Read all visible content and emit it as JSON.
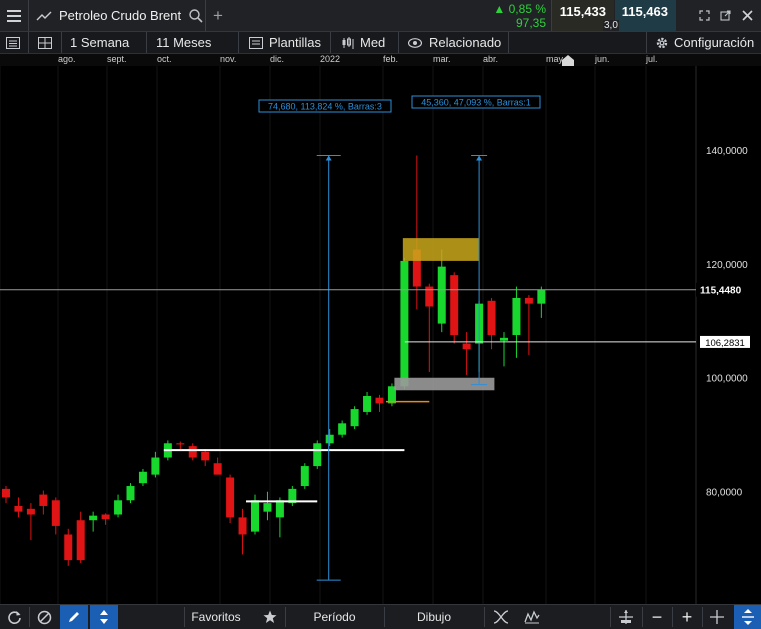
{
  "header": {
    "instrument": "Petroleo Crudo Brent",
    "change_pct": "▲ 0,85 %",
    "change_abs": "97,35",
    "sell": "115,433",
    "buy": "115,463",
    "spread": "3,0"
  },
  "toolbar": {
    "period": "1 Semana",
    "range": "11 Meses",
    "templates": "Plantillas",
    "chart_type": "Med",
    "related": "Relacionado",
    "settings": "Configuración"
  },
  "time_axis": {
    "labels": [
      "ago.",
      "sept.",
      "oct.",
      "nov.",
      "dic.",
      "2022",
      "feb.",
      "mar.",
      "abr.",
      "may.",
      "jun.",
      "jul."
    ]
  },
  "chart_data": {
    "type": "candlestick",
    "instrument": "Petroleo Crudo Brent",
    "interval": "1 Semana",
    "ylim": [
      60.3,
      154.7
    ],
    "y_ticks": [
      "140,0000",
      "120,0000",
      "100,0000",
      "80,0000"
    ],
    "y_tick_values": [
      140,
      120,
      100,
      80
    ],
    "current_price": "115,4480",
    "current_price_value": 115.448,
    "reference_price": "106,2831",
    "reference_price_value": 106.2831,
    "candles": [
      {
        "o": 80.5,
        "h": 81.0,
        "l": 78.0,
        "c": 79.0
      },
      {
        "o": 77.5,
        "h": 79.0,
        "l": 75.5,
        "c": 76.5
      },
      {
        "o": 77.0,
        "h": 78.0,
        "l": 71.5,
        "c": 76.0
      },
      {
        "o": 79.5,
        "h": 80.2,
        "l": 76.0,
        "c": 77.5
      },
      {
        "o": 78.5,
        "h": 79.0,
        "l": 72.5,
        "c": 74.0
      },
      {
        "o": 72.5,
        "h": 73.5,
        "l": 67.0,
        "c": 68.0
      },
      {
        "o": 75.0,
        "h": 76.5,
        "l": 67.5,
        "c": 68.0
      },
      {
        "o": 75.0,
        "h": 76.5,
        "l": 73.0,
        "c": 75.8
      },
      {
        "o": 76.0,
        "h": 76.2,
        "l": 74.2,
        "c": 75.2
      },
      {
        "o": 76.0,
        "h": 79.5,
        "l": 75.5,
        "c": 78.5
      },
      {
        "o": 78.5,
        "h": 81.5,
        "l": 78.0,
        "c": 81.0
      },
      {
        "o": 81.5,
        "h": 84.0,
        "l": 81.0,
        "c": 83.5
      },
      {
        "o": 83.0,
        "h": 87.0,
        "l": 82.5,
        "c": 86.0
      },
      {
        "o": 86.0,
        "h": 89.0,
        "l": 85.5,
        "c": 88.5
      },
      {
        "o": 88.5,
        "h": 88.8,
        "l": 87.5,
        "c": 88.3
      },
      {
        "o": 88.0,
        "h": 88.5,
        "l": 85.5,
        "c": 86.0
      },
      {
        "o": 87.0,
        "h": 87.5,
        "l": 84.5,
        "c": 85.5
      },
      {
        "o": 85.0,
        "h": 86.0,
        "l": 83.0,
        "c": 83.0
      },
      {
        "o": 82.5,
        "h": 83.0,
        "l": 74.5,
        "c": 75.5
      },
      {
        "o": 75.5,
        "h": 77.0,
        "l": 69.0,
        "c": 72.5
      },
      {
        "o": 73.0,
        "h": 79.5,
        "l": 72.5,
        "c": 78.5
      },
      {
        "o": 76.5,
        "h": 80.0,
        "l": 75.0,
        "c": 78.0
      },
      {
        "o": 75.5,
        "h": 79.0,
        "l": 72.0,
        "c": 78.5
      },
      {
        "o": 78.0,
        "h": 81.0,
        "l": 77.5,
        "c": 80.5
      },
      {
        "o": 81.0,
        "h": 85.0,
        "l": 80.5,
        "c": 84.5
      },
      {
        "o": 84.5,
        "h": 89.0,
        "l": 84.0,
        "c": 88.5
      },
      {
        "o": 88.5,
        "h": 91.0,
        "l": 88.0,
        "c": 90.0
      },
      {
        "o": 90.0,
        "h": 92.5,
        "l": 89.5,
        "c": 92.0
      },
      {
        "o": 91.5,
        "h": 95.0,
        "l": 91.0,
        "c": 94.5
      },
      {
        "o": 94.0,
        "h": 97.5,
        "l": 93.5,
        "c": 96.8
      },
      {
        "o": 96.5,
        "h": 97.0,
        "l": 94.0,
        "c": 95.5
      },
      {
        "o": 95.5,
        "h": 99.0,
        "l": 95.0,
        "c": 98.5
      },
      {
        "o": 98.5,
        "h": 121.0,
        "l": 98.0,
        "c": 120.5
      },
      {
        "o": 122.5,
        "h": 139.0,
        "l": 112.0,
        "c": 116.0
      },
      {
        "o": 116.0,
        "h": 116.5,
        "l": 101.0,
        "c": 112.5
      },
      {
        "o": 109.5,
        "h": 122.5,
        "l": 108.0,
        "c": 119.5
      },
      {
        "o": 118.0,
        "h": 118.5,
        "l": 106.0,
        "c": 107.5
      },
      {
        "o": 106.0,
        "h": 108.0,
        "l": 100.5,
        "c": 105.0
      },
      {
        "o": 106.0,
        "h": 113.5,
        "l": 101.0,
        "c": 113.0
      },
      {
        "o": 113.5,
        "h": 114.0,
        "l": 105.0,
        "c": 107.5
      },
      {
        "o": 106.5,
        "h": 108.0,
        "l": 102.0,
        "c": 107.0
      },
      {
        "o": 107.5,
        "h": 116.0,
        "l": 103.5,
        "c": 114.0
      },
      {
        "o": 114.0,
        "h": 114.5,
        "l": 104.0,
        "c": 113.0
      },
      {
        "o": 113.0,
        "h": 116.0,
        "l": 110.5,
        "c": 115.4
      }
    ],
    "annotations": [
      {
        "text": "74,680, 113,824 %, Barras:3"
      },
      {
        "text": "45,360, 47,093 %, Barras:1"
      }
    ],
    "colors": {
      "up": "#18d82e",
      "down": "#e01414",
      "measure": "#2d8fd8",
      "highlight_box": "#c9a81a",
      "grey_box": "#9a9a9a",
      "orange_line": "#e88a1a"
    }
  },
  "bottom_bar": {
    "favorites": "Favoritos",
    "period": "Período",
    "drawing": "Dibujo"
  }
}
